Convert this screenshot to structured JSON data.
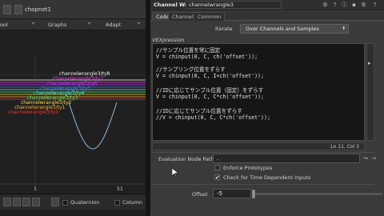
{
  "left_pane": {
    "path_node": "chopnet1",
    "menu": {
      "left": "ool",
      "graphs": "Graphs",
      "adapt": "Adapt"
    },
    "channel_labels": [
      "channelwrangle3/ty0",
      "channelwrangle3/ty1",
      "channelwrangle3/ty2",
      "channelwrangle3/ty3",
      "channelwrangle3/ty4",
      "channelwrangle3/ty5",
      "channelwrangle3/ty6",
      "channelwrangle3/ty7",
      "channelwrangle3/ty8"
    ],
    "axis": {
      "tick_1": "1",
      "tick_51": "51"
    },
    "status": {
      "quaternion": "Quaternion",
      "column": "Column"
    }
  },
  "right_pane": {
    "node_type": "Channel Wrangle",
    "node_name": "channelwrangle3",
    "tabs": [
      "Code",
      "Channel",
      "Common"
    ],
    "iterate": {
      "label": "Iterate",
      "value": "Over Channels and Samples"
    },
    "vex_label": "VEXpression",
    "code_lines": [
      "//サンプル位置を常に固定",
      "V = chinput(0, C, ch('offset'));",
      "",
      "//サンプリング位置をずらす",
      "V = chinput(0, C, I+ch('offset'));",
      "",
      "//IDに応じてサンプル位置（固定）をずらす",
      "V = chinput(0, C, C*ch('offset'));",
      "",
      "//IDに応じてサンプル位置をずらす",
      "//V = chinput(0, C, C*ch('offset'));"
    ],
    "cursor_position": "Ln 11, Col 3",
    "eval_path": {
      "label": "Evaluation Node Path",
      "value": "."
    },
    "enforce_prototypes": {
      "label": "Enforce Prototypes",
      "checked": false
    },
    "time_dependent": {
      "label": "Check for Time Dependent Inputs",
      "checked": true,
      "mark": "✔"
    },
    "offset": {
      "label": "Offset",
      "value": "-5"
    }
  },
  "colors": {
    "curve": "#8fb8d8",
    "lines": [
      "#ff3030",
      "#ffb040",
      "#ffe040",
      "#60ff60",
      "#40ffff",
      "#4080ff",
      "#c040ff",
      "#ff40ff",
      "#ffffff"
    ]
  }
}
